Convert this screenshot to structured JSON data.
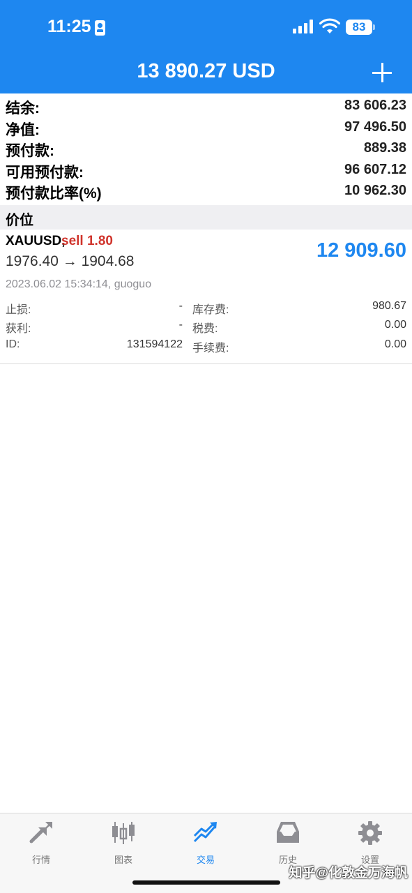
{
  "status_bar": {
    "time": "11:25",
    "battery": "83"
  },
  "header": {
    "title": "13 890.27 USD"
  },
  "summary": [
    {
      "label": "结余:",
      "value": "83 606.23"
    },
    {
      "label": "净值:",
      "value": "97 496.50"
    },
    {
      "label": "预付款:",
      "value": "889.38"
    },
    {
      "label": "可用预付款:",
      "value": "96 607.12"
    },
    {
      "label": "预付款比率(%)",
      "value": "10 962.30"
    }
  ],
  "section": {
    "title": "价位"
  },
  "position": {
    "symbol": "XAUUSD,",
    "side": "sell 1.80",
    "prices": "1976.40 → 1904.68",
    "profit": "12 909.60",
    "opened": "2023.06.02 15:34:14, guoguo",
    "details": {
      "stop_loss_label": "止损:",
      "stop_loss_value": "-",
      "swap_label": "库存费:",
      "swap_value": "980.67",
      "take_profit_label": "获利:",
      "take_profit_value": "-",
      "taxes_label": "税费:",
      "taxes_value": "0.00",
      "id_label": "ID:",
      "id_value": "131594122",
      "commission_label": "手续费:",
      "commission_value": "0.00"
    }
  },
  "tabbar": {
    "items": [
      {
        "label": "行情",
        "icon": "quotes-arrows-icon"
      },
      {
        "label": "图表",
        "icon": "candlestick-chart-icon"
      },
      {
        "label": "交易",
        "icon": "trade-trend-icon"
      },
      {
        "label": "历史",
        "icon": "history-inbox-icon"
      },
      {
        "label": "设置",
        "icon": "gear-icon"
      }
    ],
    "active": "交易"
  },
  "watermark": "知乎@化敦金万海帆",
  "colors": {
    "header_bg": "#1e87f0",
    "profit": "#1e87f0",
    "sell": "#d0342c"
  }
}
